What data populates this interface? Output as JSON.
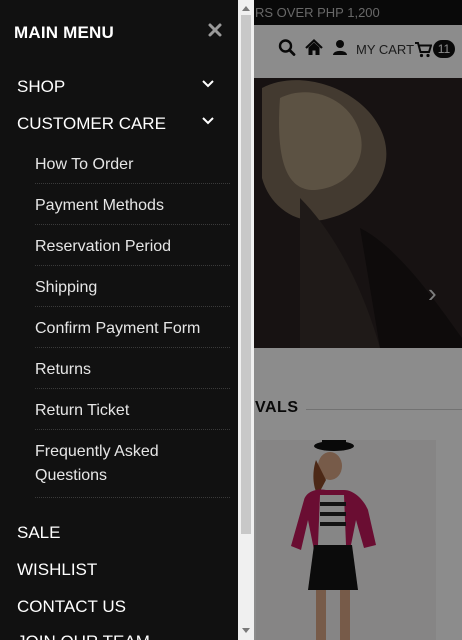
{
  "page": {
    "promo_text": "RS OVER PHP 1,200",
    "header": {
      "cart_label": "MY CART",
      "cart_count": "11"
    },
    "section_title": "VALS"
  },
  "drawer": {
    "title": "MAIN MENU",
    "items": [
      {
        "label": "SHOP",
        "expandable": true
      },
      {
        "label": "CUSTOMER CARE",
        "expandable": true,
        "expanded": true
      },
      {
        "label": "SALE"
      },
      {
        "label": "WISHLIST"
      },
      {
        "label": "CONTACT US"
      },
      {
        "label": "JOIN OUR TEAM"
      }
    ],
    "customer_care_items": [
      "How To Order",
      "Payment Methods",
      "Reservation Period",
      "Shipping",
      "Confirm Payment Form",
      "Returns",
      "Return Ticket",
      "Frequently Asked Questions"
    ]
  },
  "colors": {
    "drawer_bg": "#111111",
    "overlay": "rgba(0,0,0,0.45)",
    "badge_bg": "#111111"
  },
  "icons": [
    "close-icon",
    "chevron-down-icon",
    "search-icon",
    "home-icon",
    "user-icon",
    "cart-icon",
    "chevron-right-icon"
  ]
}
